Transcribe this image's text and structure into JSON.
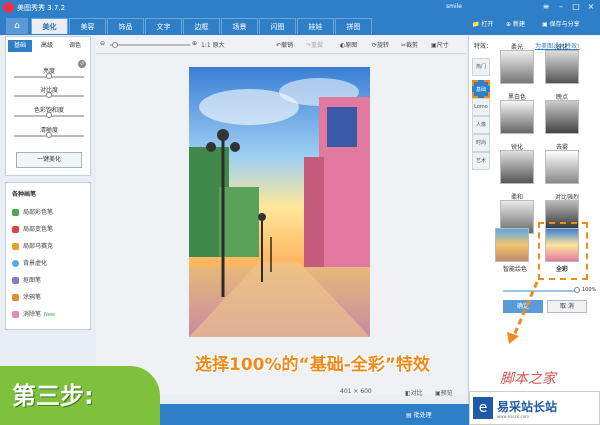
{
  "title_bar": {
    "app_name": "美图秀秀 3.7.2",
    "user": "smile"
  },
  "tabs": [
    "美化",
    "美容",
    "饰品",
    "文字",
    "边框",
    "场景",
    "闪图",
    "娃娃",
    "拼图"
  ],
  "active_tab": "美化",
  "header_actions": {
    "open": "打开",
    "new": "新建",
    "save_share": "保存与分享"
  },
  "toolbar": {
    "ratio": "1:1 原大",
    "undo": "撤销",
    "redo": "重做",
    "original": "原图",
    "rotate": "旋转",
    "crop": "裁剪",
    "size": "尺寸"
  },
  "left_panel": {
    "subtabs": [
      "基础",
      "高级",
      "调色"
    ],
    "active_subtab": "基础",
    "sliders": [
      {
        "label": "亮度",
        "value": 0.5
      },
      {
        "label": "对比度",
        "value": 0.5
      },
      {
        "label": "色彩饱和度",
        "value": 0.5
      },
      {
        "label": "清晰度",
        "value": 0.5
      }
    ],
    "one_key": "一键美化"
  },
  "brush_panel": {
    "title": "各种画笔",
    "items": [
      {
        "label": "局部彩色笔",
        "color": "#49a84b"
      },
      {
        "label": "局部变色笔",
        "color": "#d44"
      },
      {
        "label": "局部马赛克",
        "color": "#e7a12a"
      },
      {
        "label": "背景虚化",
        "color": "#5aa9e6"
      },
      {
        "label": "抠图笔",
        "color": "#8a7ac9"
      },
      {
        "label": "涂鸦笔",
        "color": "#e38a36"
      },
      {
        "label": "消除笔",
        "color": "#e58bb9",
        "badge": "New"
      }
    ]
  },
  "right_panel": {
    "header": "特效：",
    "link": "为美图设计特效!",
    "vertical_tabs": [
      "热门",
      "基础",
      "Lomo",
      "人像",
      "时尚",
      "艺术"
    ],
    "vertical_badges": {
      "人像": "NEW",
      "艺术": "NEW"
    },
    "selected_vertical": "基础",
    "effects": [
      "柔光",
      "锐化",
      "黑白色",
      "晚点",
      "锐化",
      "去雾",
      "柔和",
      "对比强烈",
      "智能绘色",
      "全彩"
    ],
    "selected_effect": "全彩",
    "opacity": "100%",
    "ok_button": "确定",
    "cancel_button": "取 消"
  },
  "status": {
    "dimensions": "401 × 600",
    "compare": "对比",
    "preview": "预览"
  },
  "bottom": {
    "batch": "批处理"
  },
  "annotation": {
    "step": "第三步:",
    "instruction": "选择100%的“基础-全彩”特效"
  },
  "watermark": {
    "script": "脚本之家",
    "brand": "易采站长站",
    "sub": "www.easck.com"
  },
  "colors": {
    "accent": "#2f7fc8",
    "orange": "#f08a1a",
    "green": "#7dc13c"
  }
}
